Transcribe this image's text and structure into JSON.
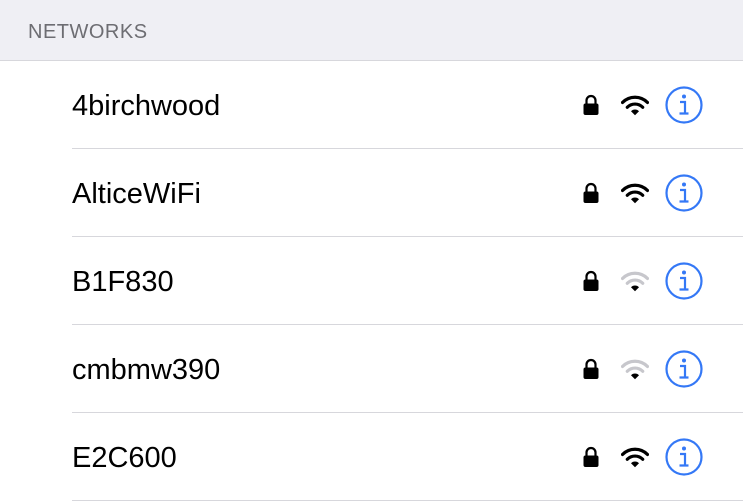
{
  "section": {
    "title": "NETWORKS"
  },
  "colors": {
    "accent": "#3478f6",
    "header_bg": "#efeff4",
    "header_text": "#6d6d72",
    "separator": "#d7d7dc",
    "wifi_active": "#000000",
    "wifi_inactive": "#c7c7cc"
  },
  "networks": [
    {
      "name": "4birchwood",
      "secured": true,
      "signal_bars": 3,
      "icons": [
        "lock-icon",
        "wifi-icon",
        "info-icon"
      ]
    },
    {
      "name": "AlticeWiFi",
      "secured": true,
      "signal_bars": 3,
      "icons": [
        "lock-icon",
        "wifi-icon",
        "info-icon"
      ]
    },
    {
      "name": "B1F830",
      "secured": true,
      "signal_bars": 1,
      "icons": [
        "lock-icon",
        "wifi-icon",
        "info-icon"
      ]
    },
    {
      "name": "cmbmw390",
      "secured": true,
      "signal_bars": 1,
      "icons": [
        "lock-icon",
        "wifi-icon",
        "info-icon"
      ]
    },
    {
      "name": "E2C600",
      "secured": true,
      "signal_bars": 3,
      "icons": [
        "lock-icon",
        "wifi-icon",
        "info-icon"
      ]
    }
  ]
}
